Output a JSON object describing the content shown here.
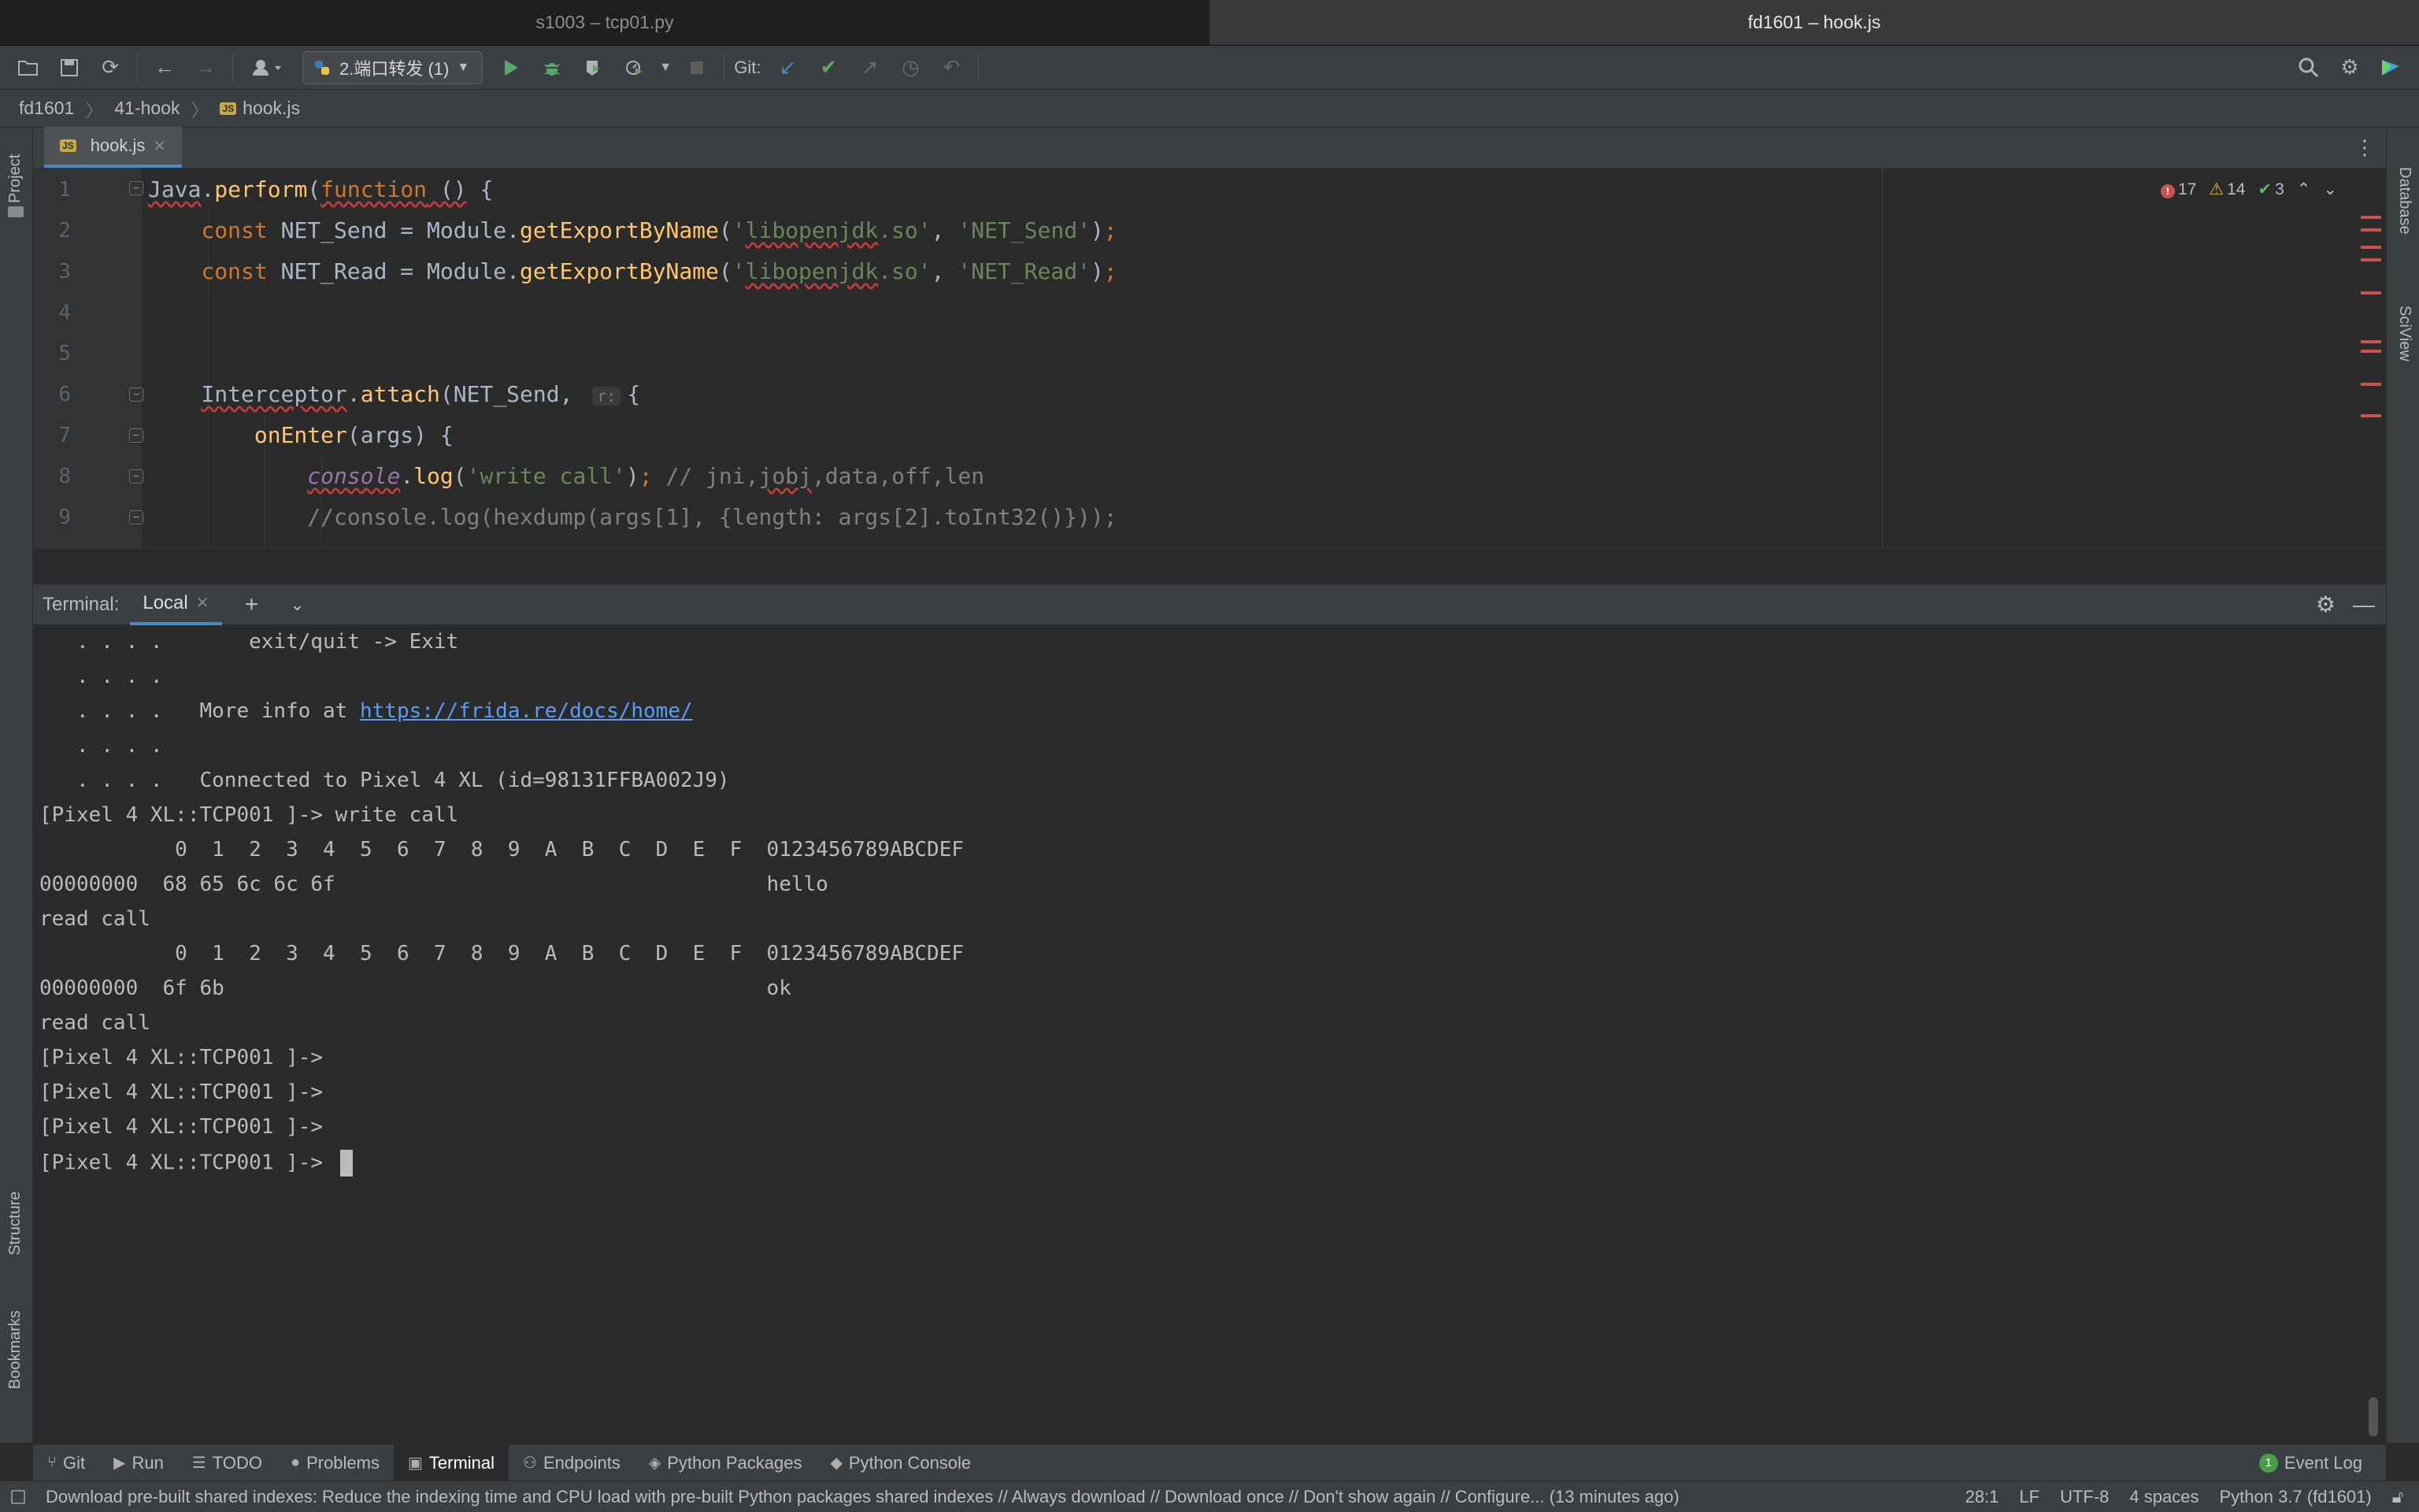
{
  "window_tabs": [
    "s1003 – tcp01.py",
    "fd1601 – hook.js"
  ],
  "toolbar": {
    "run_config": "2.端口转发 (1)",
    "git_label": "Git:"
  },
  "breadcrumb": [
    "fd1601",
    "41-hook",
    "hook.js"
  ],
  "left_strip": [
    "Project",
    "Structure",
    "Bookmarks"
  ],
  "right_strip": [
    "Database",
    "SciView"
  ],
  "editor": {
    "tab": "hook.js",
    "file_badge": "JS",
    "inspections": {
      "errors": "17",
      "warnings": "14",
      "ok": "3"
    },
    "line_numbers": [
      "1",
      "2",
      "3",
      "4",
      "5",
      "6",
      "7",
      "8",
      "9"
    ],
    "param_hint": "r:"
  },
  "terminal": {
    "label": "Terminal:",
    "tab": "Local",
    "lines": [
      "   . . . .       exit/quit -> Exit",
      "   . . . .",
      "   . . . .   More info at ",
      "   . . . .",
      "   . . . .   Connected to Pixel 4 XL (id=98131FFBA002J9)",
      "[Pixel 4 XL::TCP001 ]-> write call",
      "           0  1  2  3  4  5  6  7  8  9  A  B  C  D  E  F  0123456789ABCDEF",
      "00000000  68 65 6c 6c 6f                                   hello",
      "read call",
      "           0  1  2  3  4  5  6  7  8  9  A  B  C  D  E  F  0123456789ABCDEF",
      "00000000  6f 6b                                            ok",
      "read call",
      "[Pixel 4 XL::TCP001 ]->",
      "[Pixel 4 XL::TCP001 ]->",
      "[Pixel 4 XL::TCP001 ]->",
      "[Pixel 4 XL::TCP001 ]->"
    ],
    "link": "https://frida.re/docs/home/"
  },
  "tool_windows": [
    "Git",
    "Run",
    "TODO",
    "Problems",
    "Terminal",
    "Endpoints",
    "Python Packages",
    "Python Console"
  ],
  "event_log": {
    "label": "Event Log",
    "count": "1"
  },
  "status": {
    "message": "Download pre-built shared indexes: Reduce the indexing time and CPU load with pre-built Python packages shared indexes // Always download // Download once // Don't show again // Configure... (13 minutes ago)",
    "position": "28:1",
    "line_sep": "LF",
    "encoding": "UTF-8",
    "indent": "4 spaces",
    "interpreter": "Python 3.7 (fd1601)"
  },
  "colors": {
    "background": "#2b2b2b",
    "panel": "#3c3f41",
    "accent": "#4a88c7",
    "keyword": "#cc7832",
    "string": "#6a8759",
    "function": "#ffc66d",
    "link": "#589df6"
  }
}
